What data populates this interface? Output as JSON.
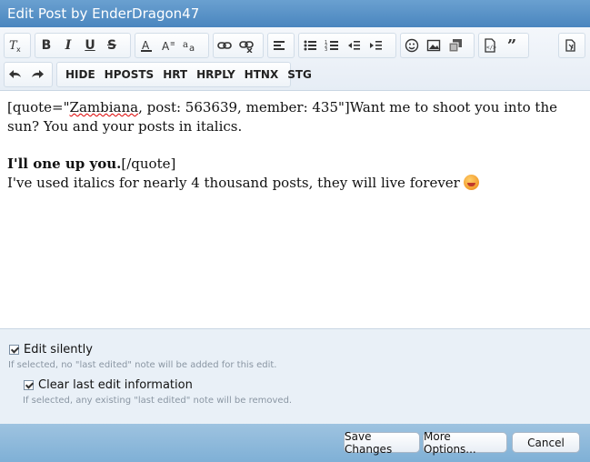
{
  "window": {
    "title": "Edit Post by EnderDragon47"
  },
  "toolbar": {
    "row1_groups": [
      [
        "remove-format-icon"
      ],
      [
        "bold-icon",
        "italic-icon",
        "underline-icon",
        "strikethrough-icon"
      ],
      [
        "text-color-icon",
        "font-size-icon",
        "font-family-icon"
      ],
      [
        "link-icon",
        "unlink-icon"
      ],
      [
        "align-icon"
      ],
      [
        "bullet-list-icon",
        "numbered-list-icon",
        "outdent-icon",
        "indent-icon"
      ],
      [
        "smilies-icon",
        "image-icon",
        "media-icon"
      ],
      [
        "code-icon",
        "quote-icon"
      ],
      [
        "toggle-bbcode-icon"
      ]
    ],
    "row2_custom_buttons": [
      "HIDE",
      "HPOSTS",
      "HRT",
      "HRPLY",
      "HTNX",
      "STG"
    ]
  },
  "editor": {
    "quote_open_1": "[quote=\"",
    "quote_name": "Zambiana",
    "quote_open_2": ", post: 563639, member: 435\"]Want me to shoot you into the sun? You and your posts in italics.",
    "bold_line": "I'll one up you.",
    "quote_close": "[/quote]",
    "reply_line": "I've used italics for nearly 4 thousand posts, they will live forever"
  },
  "options": {
    "edit_silently": {
      "label": "Edit silently",
      "checked": true,
      "hint": "If selected, no \"last edited\" note will be added for this edit."
    },
    "clear_last_edit": {
      "label": "Clear last edit information",
      "checked": true,
      "hint": "If selected, any existing \"last edited\" note will be removed."
    }
  },
  "buttons": {
    "save": "Save Changes",
    "more": "More Options...",
    "cancel": "Cancel"
  }
}
